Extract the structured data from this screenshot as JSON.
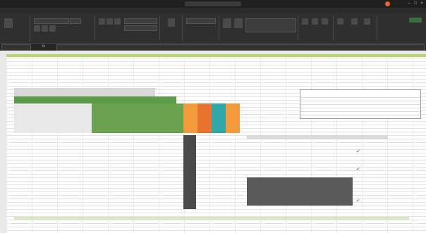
{
  "window": {
    "title": "",
    "user": "",
    "autosave": ""
  },
  "tabs": [
    {
      "label": ""
    },
    {
      "label": ""
    },
    {
      "label": ""
    },
    {
      "label": ""
    },
    {
      "label": ""
    },
    {
      "label": ""
    },
    {
      "label": ""
    },
    {
      "label": ""
    },
    {
      "label": ""
    }
  ],
  "ribbon": {
    "groups": [
      "",
      "",
      "",
      "",
      "",
      "",
      "",
      ""
    ],
    "font_name": "",
    "font_size": ""
  },
  "formula_bar": {
    "cell_ref": "",
    "formula": ""
  },
  "sheet": {
    "banner": "",
    "instructions": [
      "",
      "",
      "",
      ""
    ],
    "warning": "",
    "section_title": "",
    "right_title": "",
    "speaker_lines": [
      "",
      "",
      "",
      "",
      "",
      "",
      "",
      "",
      "",
      "",
      "",
      "",
      "",
      "",
      "",
      "",
      ""
    ],
    "column_headers": [
      "",
      "",
      "",
      "",
      "",
      "",
      "",
      "",
      ""
    ],
    "power_calc_title": "",
    "footer_note": [
      "",
      ""
    ]
  },
  "colors": {
    "green_header": "#5b9b4a",
    "banner": "#b7d66e",
    "orange": "#f39a3b",
    "teal": "#2fa8a8",
    "dark_block": "#4a4a4a"
  }
}
